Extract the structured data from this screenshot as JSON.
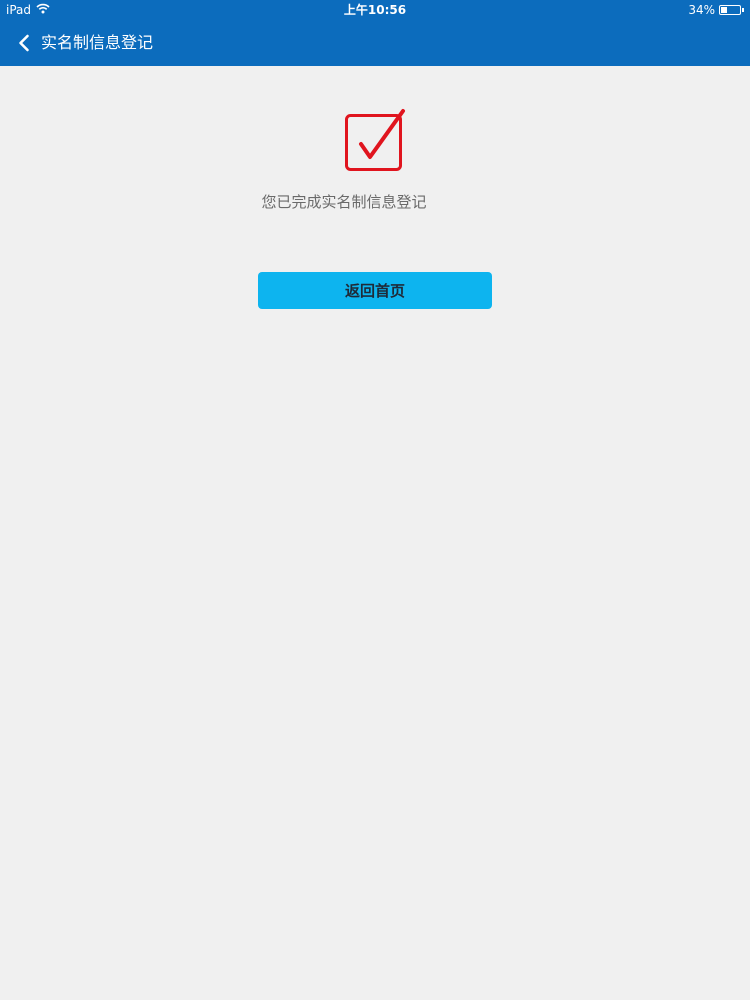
{
  "status_bar": {
    "device": "iPad",
    "time": "上午10:56",
    "battery_percent": "34%",
    "battery_level": 0.34,
    "wifi_icon": "wifi-icon"
  },
  "nav": {
    "back_icon": "chevron-left-icon",
    "title": "实名制信息登记"
  },
  "content": {
    "success_icon": "checkbox-checked-icon",
    "message": "您已完成实名制信息登记",
    "home_button_label": "返回首页"
  },
  "colors": {
    "header_bg": "#0c6cbd",
    "page_bg": "#f0f0f0",
    "check_red": "#e0141e",
    "button_bg": "#0db4ef"
  }
}
